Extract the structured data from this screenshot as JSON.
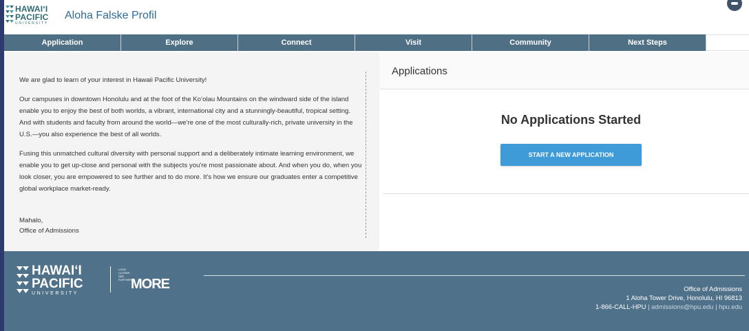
{
  "header": {
    "logo_line1": "HAWAIʻI",
    "logo_line2": "PACIFIC",
    "logo_line3": "UNIVERSITY",
    "portal_title": "Aloha Falske Profil",
    "user_icon": "user-avatar-icon"
  },
  "nav": {
    "items": [
      {
        "label": "Application"
      },
      {
        "label": "Explore"
      },
      {
        "label": "Connect"
      },
      {
        "label": "Visit"
      },
      {
        "label": "Community"
      },
      {
        "label": "Next Steps"
      }
    ],
    "active_color": "#4f6f85"
  },
  "intro": {
    "p1": "We are glad to learn of your interest in Hawaii Pacific University!",
    "p2": "Our campuses in downtown Honolulu and at the foot of the Koʻolau Mountains on the windward side of the island enable you to enjoy the best of both worlds, a vibrant, international city and a stunningly-beautiful, tropical setting. And with students and faculty from around the world—we're one of the most culturally-rich, private university in the U.S.—you also experience the best of all worlds.",
    "p3": "Fusing this unmatched cultural diversity with personal support and a deliberately intimate learning environment, we enable you to get up-close and personal with the subjects you're most passionate about. And when you do, when you look closer, you are empowered to see further and to do more. It's how we ensure our graduates enter a competitive global workplace market-ready.",
    "closing": "Mahalo,",
    "signature": "Office of Admissions"
  },
  "applications": {
    "title": "Applications",
    "empty_message": "No Applications Started",
    "start_button": "START A NEW APPLICATION",
    "button_color": "#3e9bd8"
  },
  "footer": {
    "logo_line1": "HAWAIʻI",
    "logo_line2": "PACIFIC",
    "logo_line3": "UNIVERSITY",
    "tag_line1": "LOOK",
    "tag_line2": "CLOSER.",
    "tag_line3": "SEE",
    "tag_line4": "FURTHER.",
    "tag_more": "MORE",
    "office": "Office of Admissions",
    "address": "1 Aloha Tower Drive, Honolulu, HI 96813",
    "phone": "1-866-CALL-HPU",
    "contact_rest": " | admissions@hpu.edu | hpu.edu",
    "background": "#50718a"
  }
}
